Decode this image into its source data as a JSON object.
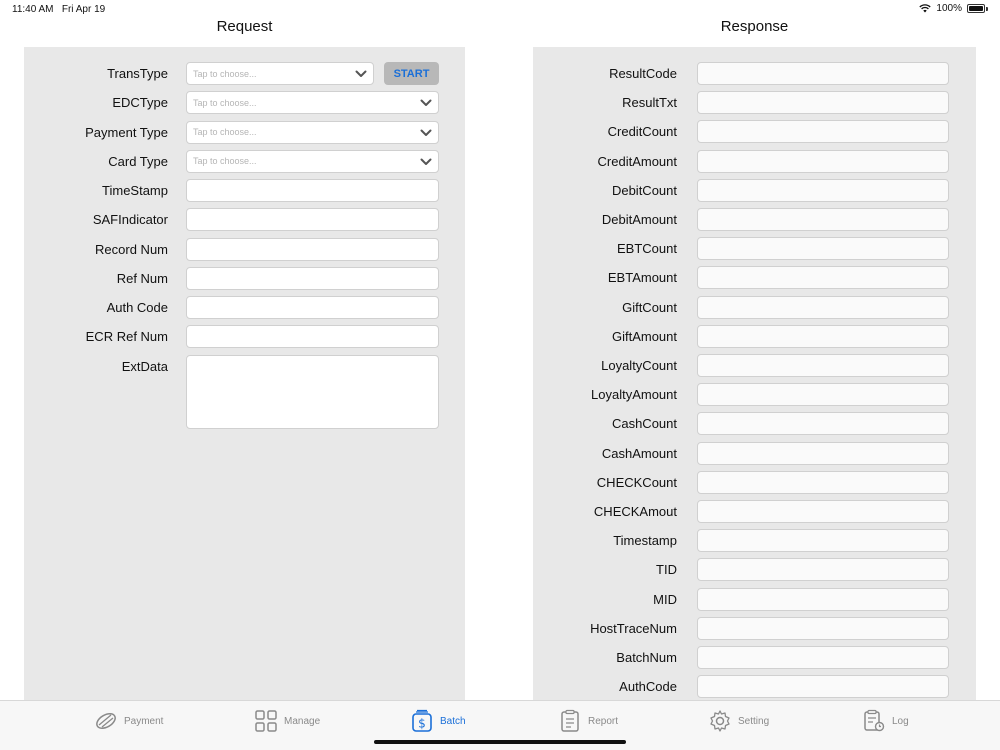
{
  "status": {
    "time": "11:40 AM",
    "date": "Fri Apr 19",
    "battery": "100%"
  },
  "request": {
    "title": "Request",
    "start_label": "START",
    "placeholder": "Tap to choose...",
    "rows": [
      {
        "label": "TransType",
        "kind": "select"
      },
      {
        "label": "EDCType",
        "kind": "select"
      },
      {
        "label": "Payment Type",
        "kind": "select"
      },
      {
        "label": "Card Type",
        "kind": "select"
      },
      {
        "label": "TimeStamp",
        "kind": "text"
      },
      {
        "label": "SAFIndicator",
        "kind": "text"
      },
      {
        "label": "Record Num",
        "kind": "text"
      },
      {
        "label": "Ref Num",
        "kind": "text"
      },
      {
        "label": "Auth Code",
        "kind": "text"
      },
      {
        "label": "ECR Ref Num",
        "kind": "text"
      },
      {
        "label": "ExtData",
        "kind": "area"
      }
    ]
  },
  "response": {
    "title": "Response",
    "rows": [
      "ResultCode",
      "ResultTxt",
      "CreditCount",
      "CreditAmount",
      "DebitCount",
      "DebitAmount",
      "EBTCount",
      "EBTAmount",
      "GiftCount",
      "GiftAmount",
      "LoyaltyCount",
      "LoyaltyAmount",
      "CashCount",
      "CashAmount",
      "CHECKCount",
      "CHECKAmout",
      "Timestamp",
      "TID",
      "MID",
      "HostTraceNum",
      "BatchNum",
      "AuthCode"
    ]
  },
  "tabs": [
    {
      "label": "Payment",
      "icon": "payment-icon",
      "active": false
    },
    {
      "label": "Manage",
      "icon": "manage-grid-icon",
      "active": false
    },
    {
      "label": "Batch",
      "icon": "batch-dollar-icon",
      "active": true
    },
    {
      "label": "Report",
      "icon": "report-icon",
      "active": false
    },
    {
      "label": "Setting",
      "icon": "gear-icon",
      "active": false
    },
    {
      "label": "Log",
      "icon": "log-icon",
      "active": false
    }
  ],
  "colors": {
    "accent": "#1a6fd8",
    "panel": "#e8e8e8"
  }
}
